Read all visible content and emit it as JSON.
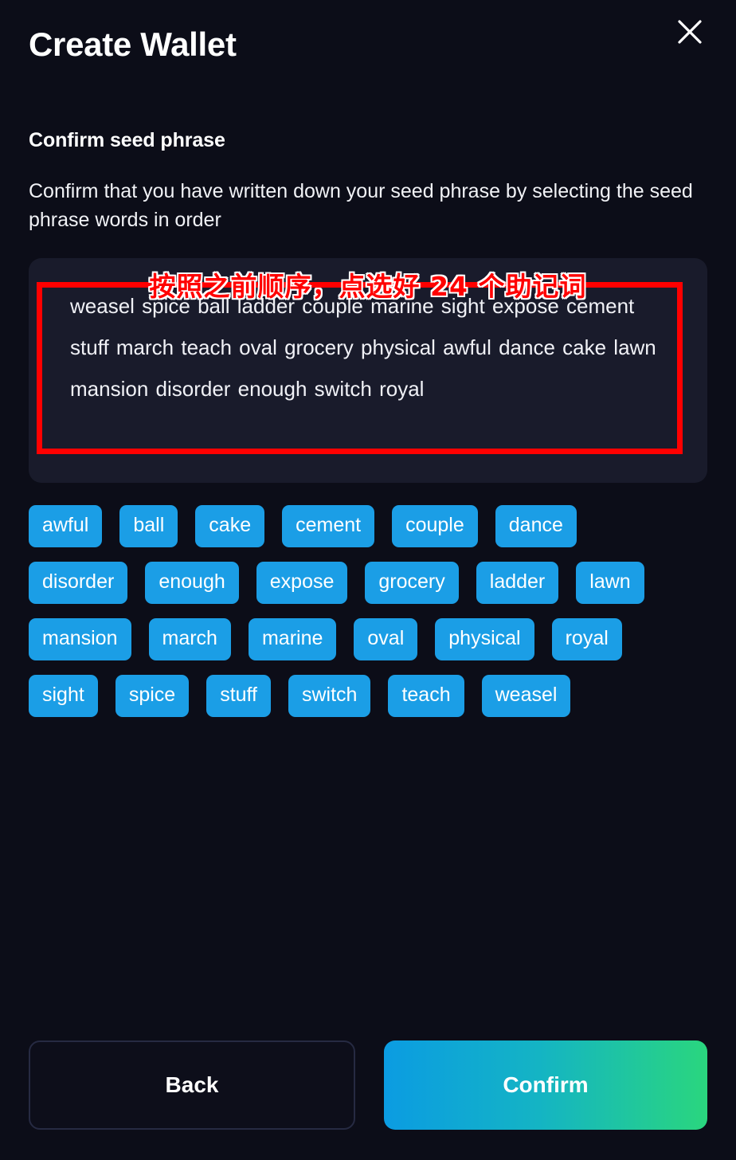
{
  "window": {
    "title": "Create Wallet",
    "close_icon": "close-icon"
  },
  "section": {
    "heading": "Confirm seed phrase",
    "description": "Confirm that you have written down your seed phrase by selecting the seed phrase words in order"
  },
  "annotation": {
    "text": "按照之前顺序，点选好 24 个助记词",
    "color": "#ff0000",
    "outline_color": "#ffffff"
  },
  "seed_phrase": {
    "text": "weasel spice ball ladder couple marine sight expose cement stuff march teach oval grocery physical awful dance cake lawn mansion disorder enough switch royal",
    "words": [
      "weasel",
      "spice",
      "ball",
      "ladder",
      "couple",
      "marine",
      "sight",
      "expose",
      "cement",
      "stuff",
      "march",
      "teach",
      "oval",
      "grocery",
      "physical",
      "awful",
      "dance",
      "cake",
      "lawn",
      "mansion",
      "disorder",
      "enough",
      "switch",
      "royal"
    ],
    "count": 24,
    "highlight_border_color": "#ff0000",
    "box_background": "#191b2b"
  },
  "word_chips": {
    "color": "#1b9ee6",
    "items": [
      "awful",
      "ball",
      "cake",
      "cement",
      "couple",
      "dance",
      "disorder",
      "enough",
      "expose",
      "grocery",
      "ladder",
      "lawn",
      "mansion",
      "march",
      "marine",
      "oval",
      "physical",
      "royal",
      "sight",
      "spice",
      "stuff",
      "switch",
      "teach",
      "weasel"
    ]
  },
  "footer": {
    "back_label": "Back",
    "confirm_label": "Confirm",
    "confirm_gradient_start": "#0b9ce2",
    "confirm_gradient_end": "#2ad67e"
  }
}
